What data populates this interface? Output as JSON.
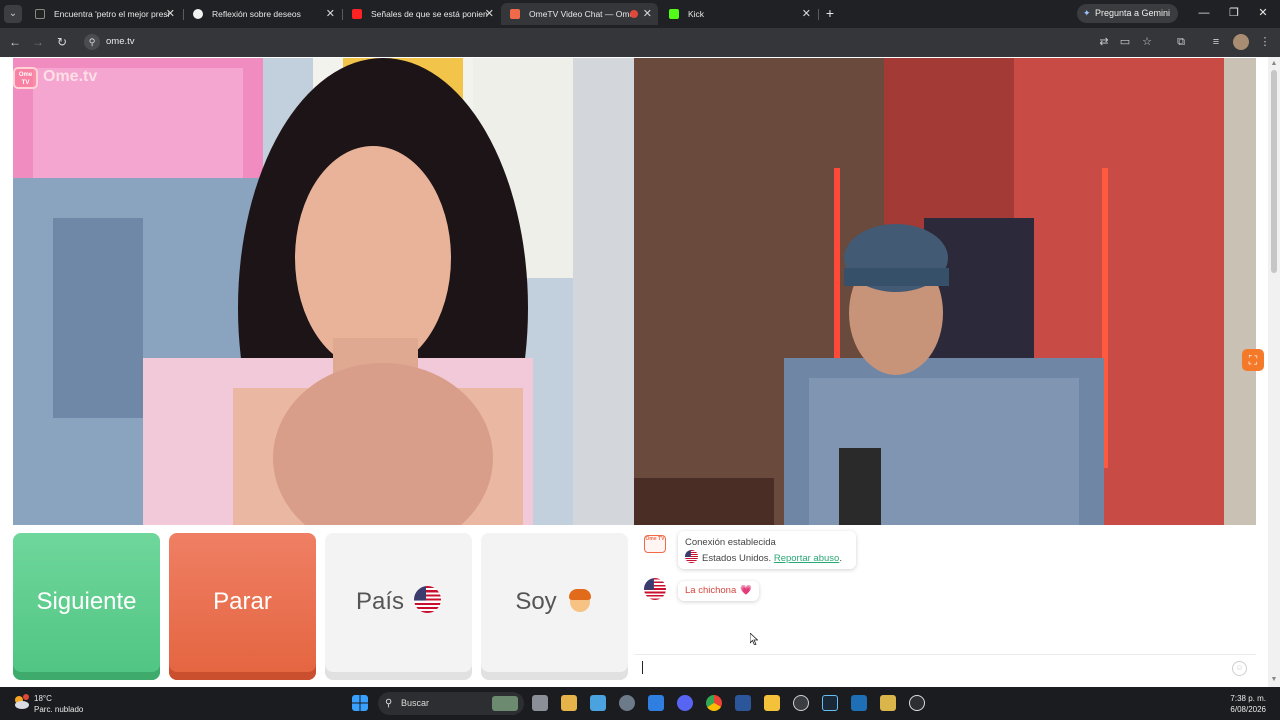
{
  "browser": {
    "tabs": [
      {
        "title": "Encuentra 'petro el mejor presi",
        "favicon_color": "#222222",
        "active": false
      },
      {
        "title": "Reflexión sobre deseos",
        "favicon_color": "#f2f2f2",
        "active": false
      },
      {
        "title": "Señales de que se está ponien",
        "favicon_color": "#ff2222",
        "active": false
      },
      {
        "title": "OmeTV Video Chat — Ome",
        "favicon_color": "#f06a4a",
        "active": true
      },
      {
        "title": "Kick",
        "favicon_color": "#53fc18",
        "active": false
      }
    ],
    "new_tab_label": "+",
    "gemini_label": "Pregunta a Gemini",
    "window_controls": {
      "minimize": "—",
      "maximize": "❐",
      "close": "✕"
    },
    "url": "ome.tv",
    "nav_icons": [
      "back-icon",
      "forward-icon",
      "reload-icon"
    ],
    "toolbar_icons": [
      "translate-icon",
      "cast-icon",
      "star-icon",
      "extensions-icon",
      "media-icon",
      "menu-icon"
    ]
  },
  "page": {
    "logo_text": "Ome.tv",
    "logo_box_text": "Ome TV",
    "buttons": {
      "next": "Siguiente",
      "stop": "Parar",
      "country": "País",
      "soy": "Soy"
    },
    "chat": {
      "system_line1": "Conexión establecida",
      "system_line2": "Estados Unidos.",
      "report_link": "Reportar abuso",
      "report_link_suffix": ".",
      "message": "La chichona",
      "heart": "💗",
      "emoji_glyph": "☺"
    }
  },
  "taskbar": {
    "temperature": "18°C",
    "weather": "Parc. nublado",
    "search_placeholder": "Buscar",
    "time": "7:38 p. m.",
    "date": "6/08/2026"
  },
  "colors": {
    "next_button": "#5ccc8c",
    "stop_button": "#ea6f4e",
    "neutral_button": "#f3f3f3",
    "report_link": "#2aa874",
    "message_text": "#d2453c"
  }
}
